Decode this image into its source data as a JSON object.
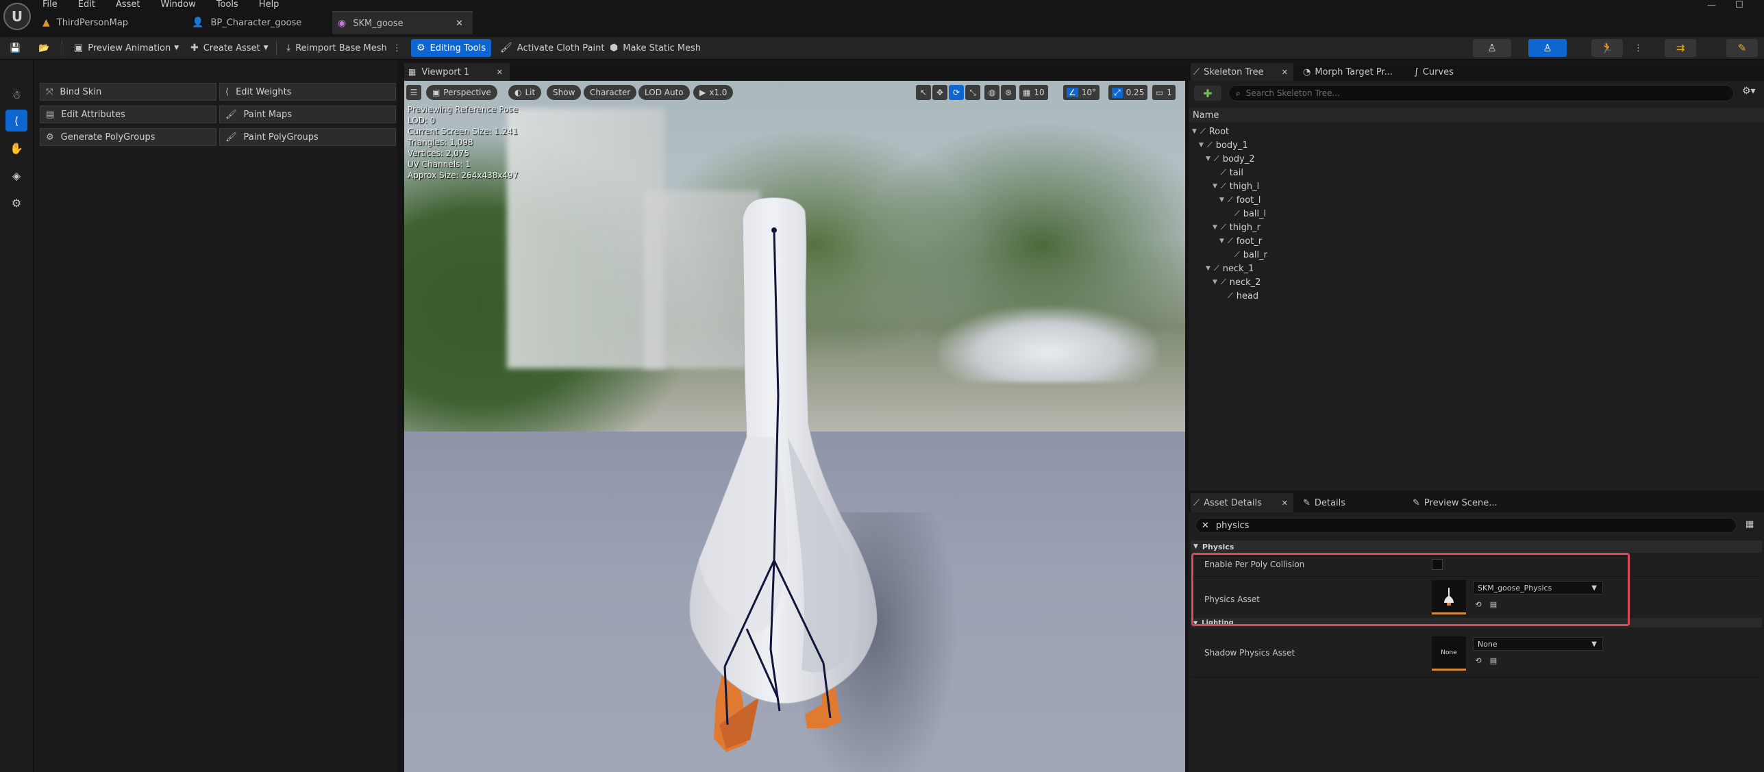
{
  "menu": [
    "File",
    "Edit",
    "Asset",
    "Window",
    "Tools",
    "Help"
  ],
  "tabs": [
    {
      "label": "ThirdPersonMap",
      "icon": "level-icon"
    },
    {
      "label": "BP_Character_goose",
      "icon": "blueprint-icon"
    },
    {
      "label": "SKM_goose",
      "icon": "skeletal-mesh-icon",
      "active": true
    }
  ],
  "toolbar": {
    "preview_animation": "Preview Animation",
    "create_asset": "Create Asset",
    "reimport": "Reimport Base Mesh",
    "editing_tools": "Editing Tools",
    "cloth_paint": "Activate Cloth Paint",
    "make_static": "Make Static Mesh"
  },
  "tools": [
    {
      "label": "Bind Skin",
      "icon": "bind-skin-icon"
    },
    {
      "label": "Edit Weights",
      "icon": "edit-weights-icon"
    },
    {
      "label": "Edit Attributes",
      "icon": "edit-attributes-icon"
    },
    {
      "label": "Paint Maps",
      "icon": "paint-maps-icon"
    },
    {
      "label": "Generate PolyGroups",
      "icon": "generate-polygroups-icon"
    },
    {
      "label": "Paint PolyGroups",
      "icon": "paint-polygroups-icon"
    }
  ],
  "viewport": {
    "tab": "Viewport 1",
    "buttons": {
      "perspective": "Perspective",
      "lit": "Lit",
      "show": "Show",
      "character": "Character",
      "lod": "LOD Auto",
      "speed": "x1.0"
    },
    "icon_values": {
      "grid": "10",
      "angle": "10°",
      "scale": "0.25",
      "camera": "1"
    },
    "stats": [
      "Previewing Reference Pose",
      "LOD: 0",
      "Current Screen Size: 1.241",
      "Triangles: 1,098",
      "Vertices: 2,075",
      "UV Channels: 1",
      "Approx Size: 264x438x497"
    ]
  },
  "skeleton": {
    "tabs": [
      "Skeleton Tree",
      "Morph Target Pr...",
      "Curves"
    ],
    "search_placeholder": "Search Skeleton Tree...",
    "header": "Name",
    "bones": [
      {
        "name": "Root",
        "depth": 0,
        "expander": true
      },
      {
        "name": "body_1",
        "depth": 1,
        "expander": true
      },
      {
        "name": "body_2",
        "depth": 2,
        "expander": true
      },
      {
        "name": "tail",
        "depth": 3,
        "expander": false
      },
      {
        "name": "thigh_l",
        "depth": 3,
        "expander": true
      },
      {
        "name": "foot_l",
        "depth": 4,
        "expander": true
      },
      {
        "name": "ball_l",
        "depth": 5,
        "expander": false
      },
      {
        "name": "thigh_r",
        "depth": 3,
        "expander": true
      },
      {
        "name": "foot_r",
        "depth": 4,
        "expander": true
      },
      {
        "name": "ball_r",
        "depth": 5,
        "expander": false
      },
      {
        "name": "neck_1",
        "depth": 2,
        "expander": true
      },
      {
        "name": "neck_2",
        "depth": 3,
        "expander": true
      },
      {
        "name": "head",
        "depth": 4,
        "expander": false
      }
    ]
  },
  "details": {
    "tabs": [
      "Asset Details",
      "Details",
      "Preview Scene..."
    ],
    "search_value": "physics",
    "physics_category": "Physics",
    "per_poly_label": "Enable Per Poly Collision",
    "physics_asset_label": "Physics Asset",
    "physics_asset_value": "SKM_goose_Physics",
    "lighting_category": "Lighting",
    "shadow_label": "Shadow Physics Asset",
    "shadow_thumb": "None",
    "shadow_value": "None"
  },
  "colors": {
    "accent": "#0f66d0",
    "highlight": "#e0455a",
    "goose_foot": "#e07a30"
  }
}
